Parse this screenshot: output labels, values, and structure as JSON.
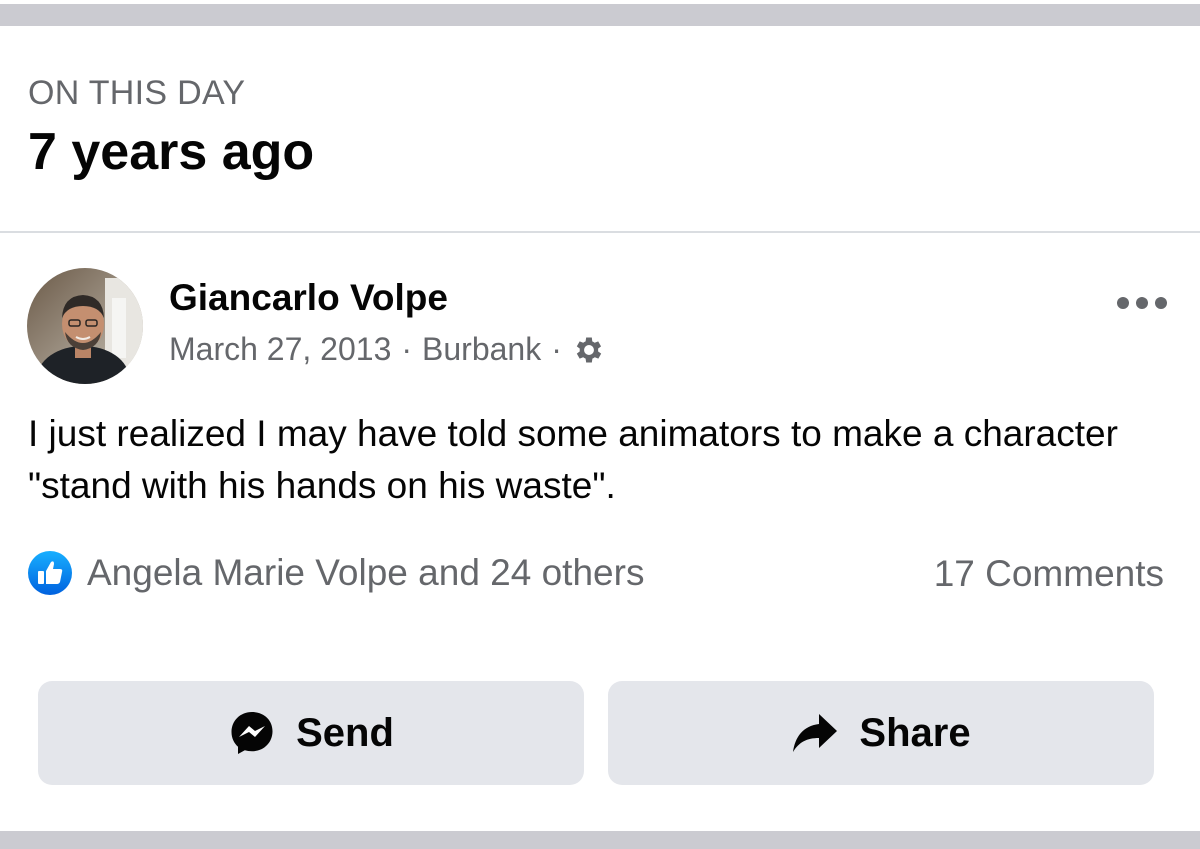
{
  "memory": {
    "eyebrow": "ON THIS DAY",
    "headline": "7 years ago"
  },
  "post": {
    "author": "Giancarlo Volpe",
    "date": "March 27, 2013",
    "location": "Burbank",
    "privacy_icon": "gear-icon",
    "more_icon": "more-icon",
    "text": "I just realized I may have told some animators to make a character \"stand with his hands on his waste\"."
  },
  "engagement": {
    "reaction_icon": "like-icon",
    "reactions_text": "Angela Marie Volpe and 24 others",
    "comments_text": "17 Comments"
  },
  "actions": {
    "send_label": "Send",
    "send_icon": "messenger-icon",
    "share_label": "Share",
    "share_icon": "share-arrow-icon"
  },
  "colors": {
    "accent": "#1877f2",
    "button_bg": "#e4e6eb",
    "secondary_text": "#65676b",
    "separator_band": "#cbcbd1"
  }
}
